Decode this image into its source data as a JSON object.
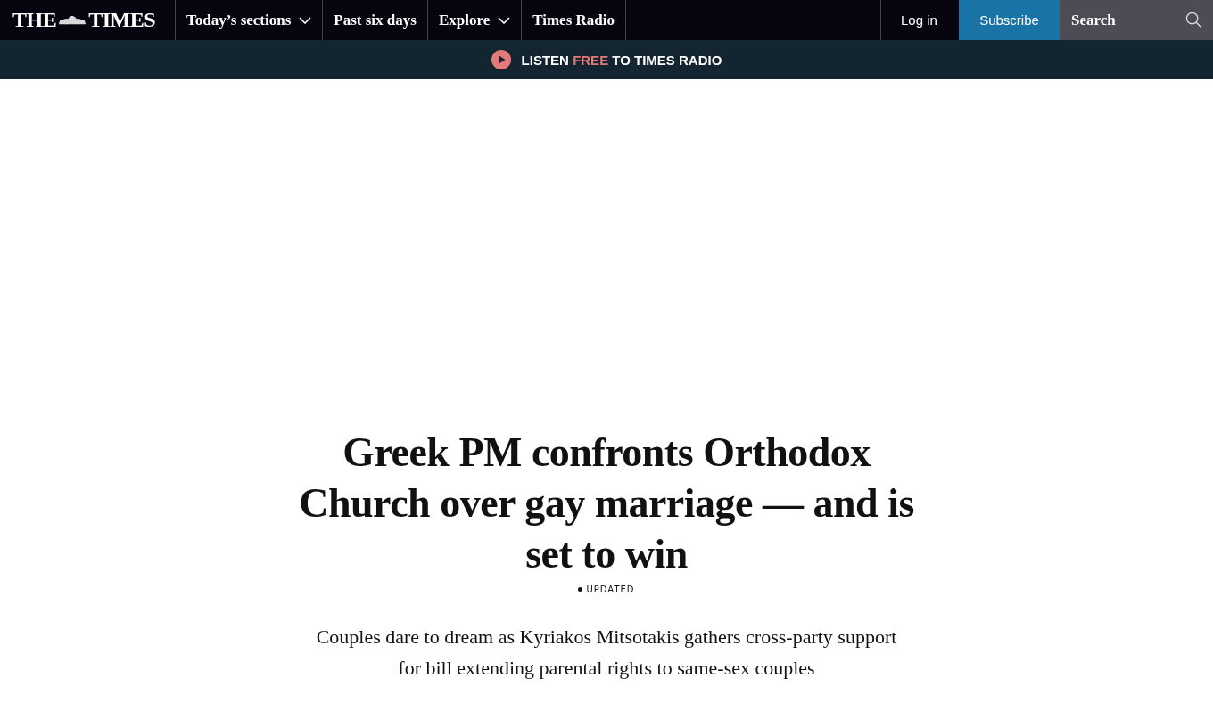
{
  "header": {
    "logo": {
      "left": "THE",
      "right": "TIMES"
    },
    "nav": [
      {
        "label": "Today’s sections",
        "has_dropdown": true
      },
      {
        "label": "Past six days",
        "has_dropdown": false
      },
      {
        "label": "Explore",
        "has_dropdown": true
      },
      {
        "label": "Times Radio",
        "has_dropdown": false
      }
    ],
    "login": "Log in",
    "subscribe": "Subscribe",
    "search": {
      "placeholder": "Search"
    }
  },
  "banner": {
    "parts": [
      {
        "text": "LISTEN",
        "highlight": false
      },
      {
        "text": "FREE",
        "highlight": true
      },
      {
        "text": "TO TIMES RADIO",
        "highlight": false
      }
    ]
  },
  "article": {
    "headline": "Greek PM confronts Orthodox Church over gay marriage — and is set to win",
    "status": "UPDATED",
    "standfirst": "Couples dare to dream as Kyriakos Mitsotakis gathers cross-party support for bill extending parental rights to same-sex couples"
  }
}
